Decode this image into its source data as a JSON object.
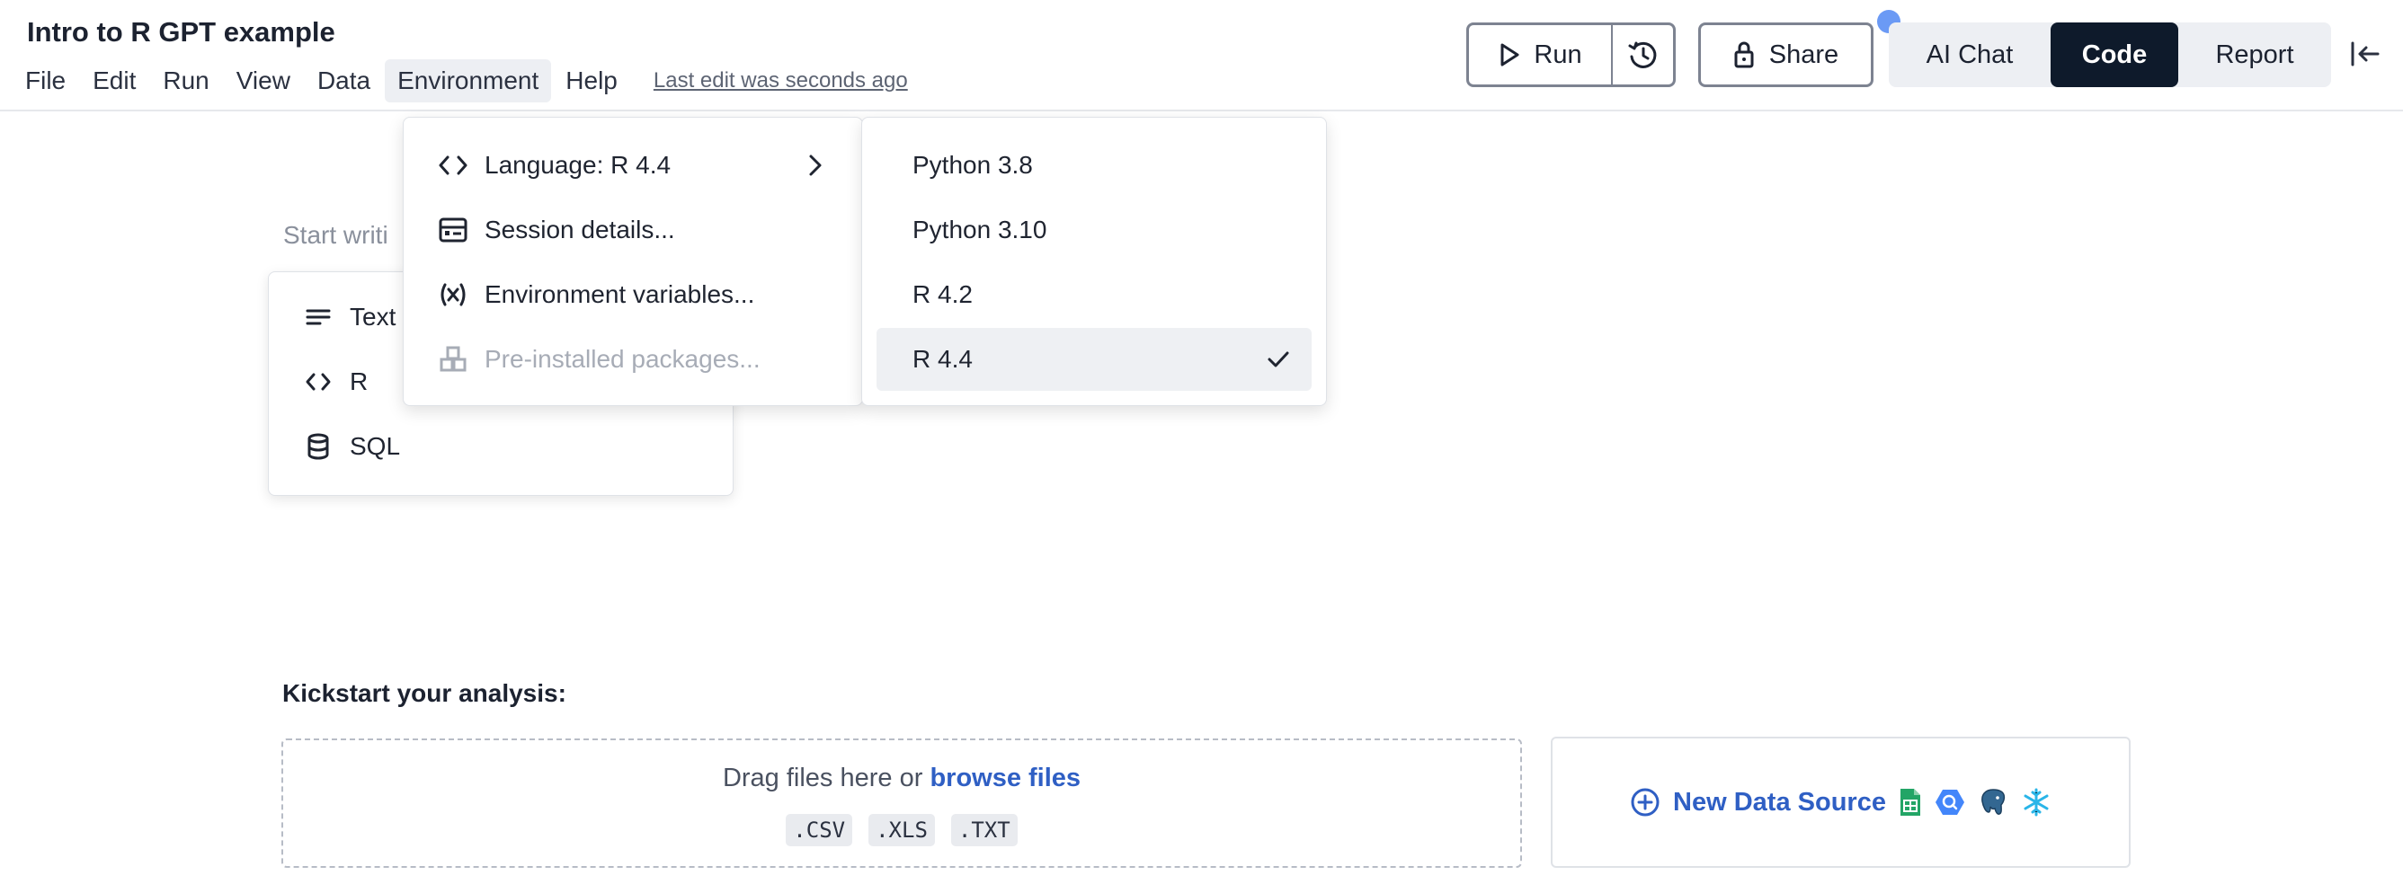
{
  "notebook": {
    "title": "Intro to R GPT example",
    "last_edit": "Last edit was seconds ago"
  },
  "menubar": {
    "items": [
      "File",
      "Edit",
      "Run",
      "View",
      "Data",
      "Environment",
      "Help"
    ],
    "active": "Environment"
  },
  "toolbar": {
    "run_label": "Run",
    "share_label": "Share"
  },
  "view_switch": {
    "ai_chat": "AI Chat",
    "code": "Code",
    "report": "Report",
    "active": "Code"
  },
  "editor": {
    "placeholder": "Start writi"
  },
  "insert_menu": {
    "items": [
      "Text",
      "R",
      "SQL"
    ]
  },
  "environment_menu": {
    "items": [
      {
        "label": "Language: R 4.4",
        "icon": "code-brackets-icon",
        "has_submenu": true
      },
      {
        "label": "Session details...",
        "icon": "session-details-icon"
      },
      {
        "label": "Environment variables...",
        "icon": "variable-icon"
      },
      {
        "label": "Pre-installed packages...",
        "icon": "packages-icon",
        "disabled": true
      }
    ]
  },
  "language_submenu": {
    "items": [
      "Python 3.8",
      "Python 3.10",
      "R 4.2",
      "R 4.4"
    ],
    "selected": "R 4.4"
  },
  "kickstart": {
    "heading": "Kickstart your analysis:",
    "drop_text": "Drag files here or",
    "browse_link": "browse files",
    "file_types": [
      ".CSV",
      ".XLS",
      ".TXT"
    ],
    "new_data_source": "New Data Source"
  },
  "colors": {
    "accent": "#2f5fc4",
    "code_tab_bg": "#0e1a2b",
    "notif_dot": "#6b9af5"
  }
}
